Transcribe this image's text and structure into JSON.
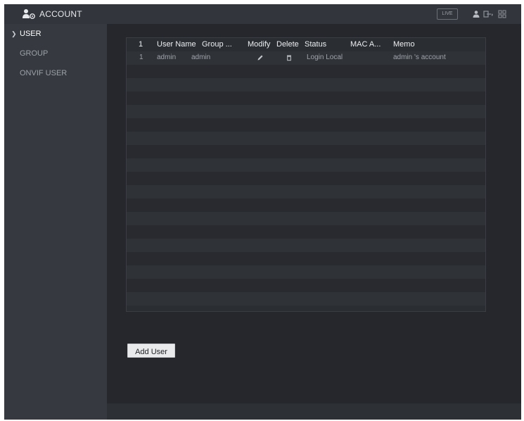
{
  "window": {
    "title": "ACCOUNT",
    "live_label": "LIVE",
    "icons": [
      "account-icon",
      "user-icon",
      "logout-icon",
      "menu-icon"
    ]
  },
  "sidebar": {
    "items": [
      {
        "label": "USER",
        "active": true
      },
      {
        "label": "GROUP",
        "active": false
      },
      {
        "label": "ONVIF USER",
        "active": false
      }
    ]
  },
  "user_table": {
    "columns": [
      "1",
      "User Name",
      "Group ...",
      "Modify",
      "Delete",
      "Status",
      "MAC A...",
      "Memo"
    ],
    "rows": [
      {
        "index": "1",
        "user_name": "admin",
        "group": "admin",
        "modify_icon": "pencil-icon",
        "delete_icon": "trash-icon",
        "status": "Login Local",
        "mac": "",
        "memo": "admin 's account"
      }
    ]
  },
  "actions": {
    "add_user_label": "Add User"
  },
  "colors": {
    "background": "#25272c",
    "sidebar": "#363940",
    "titlebar": "#32353b",
    "button": "#e9eaec"
  }
}
